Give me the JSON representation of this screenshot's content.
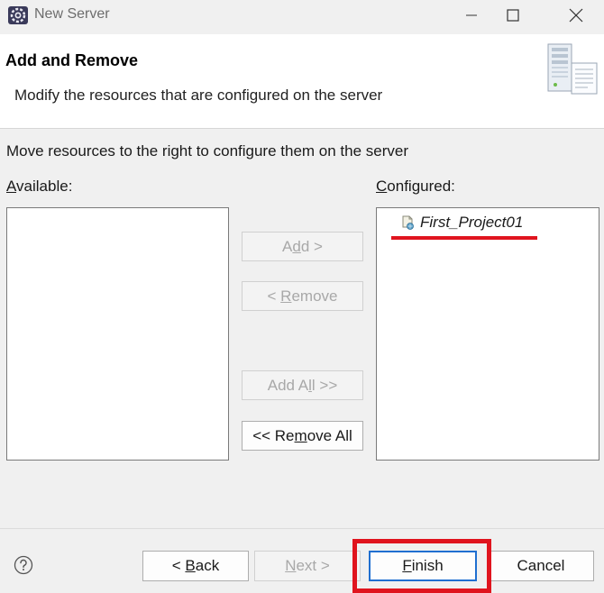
{
  "window": {
    "title": "New Server",
    "app_icon": "eclipse-gear-icon"
  },
  "banner": {
    "title": "Add and Remove",
    "description": "Modify the resources that are configured on the server",
    "art_icon": "server-document-icon"
  },
  "content": {
    "instruction": "Move resources to the right to configure them on the server",
    "available": {
      "mnemonic": "A",
      "rest": "vailable:"
    },
    "configured": {
      "mnemonic": "C",
      "rest": "onfigured:"
    },
    "configured_items": [
      {
        "label": "First_Project01",
        "icon": "web-project-icon"
      }
    ]
  },
  "buttons": {
    "add": {
      "pre": "A",
      "mnemonic": "d",
      "post": "d >",
      "enabled": false
    },
    "remove": {
      "pre": "< ",
      "mnemonic": "R",
      "post": "emove",
      "enabled": false
    },
    "add_all": {
      "pre": "Add A",
      "mnemonic": "l",
      "post": "l >>",
      "enabled": false
    },
    "remove_all": {
      "pre": "<< Re",
      "mnemonic": "m",
      "post": "ove All",
      "enabled": true
    }
  },
  "footer": {
    "help_icon": "help-icon",
    "back": {
      "pre": "< ",
      "mnemonic": "B",
      "post": "ack",
      "enabled": true
    },
    "next": {
      "pre": "",
      "mnemonic": "N",
      "post": "ext >",
      "enabled": false
    },
    "finish": {
      "pre": "",
      "mnemonic": "F",
      "post": "inish",
      "enabled": true
    },
    "cancel": {
      "label": "Cancel",
      "enabled": true
    }
  },
  "colors": {
    "highlight_red": "#e0141e",
    "default_button_border": "#1f6fd0",
    "disabled_text": "#a8a8a8"
  }
}
